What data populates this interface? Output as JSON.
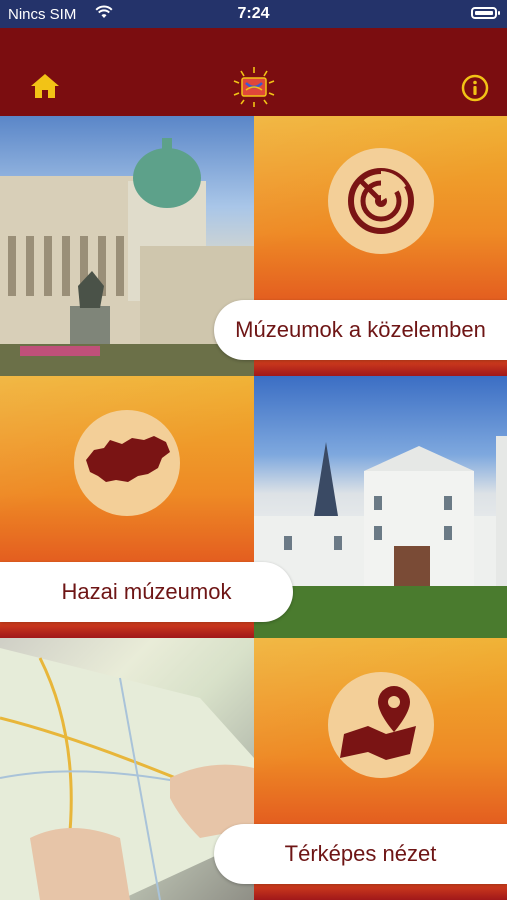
{
  "status_bar": {
    "carrier": "Nincs SIM",
    "time": "7:24"
  },
  "header": {
    "home_icon": "home-icon",
    "logo_icon": "museum-logo-icon",
    "info_icon": "info-icon",
    "accent_color": "#f2c316",
    "background_color": "#7b0d10"
  },
  "tiles": {
    "nearby_label": "Múzeumok a közelemben",
    "domestic_label": "Hazai múzeumok",
    "map_label": "Térképes nézet"
  },
  "colors": {
    "label_text": "#6e1515",
    "circle_fill": "#f3cf98",
    "icon_fill": "#7a1414"
  }
}
